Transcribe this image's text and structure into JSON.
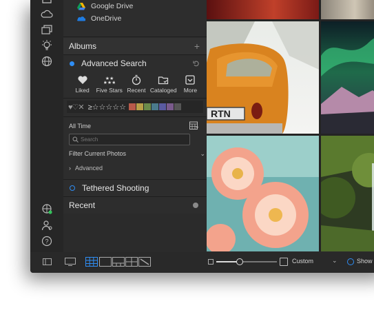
{
  "cloud_items": [
    {
      "label": "Google Drive",
      "icon": "google-drive-icon"
    },
    {
      "label": "OneDrive",
      "icon": "onedrive-icon"
    }
  ],
  "albums": {
    "label": "Albums",
    "add": "+"
  },
  "advanced_search": {
    "label": "Advanced Search"
  },
  "quick_filters": [
    {
      "label": "Liked",
      "icon": "heart-icon"
    },
    {
      "label": "Five Stars",
      "icon": "five-stars-icon"
    },
    {
      "label": "Recent",
      "icon": "stopwatch-icon"
    },
    {
      "label": "Cataloged",
      "icon": "folder-check-icon"
    },
    {
      "label": "More",
      "icon": "more-checkbox-icon"
    }
  ],
  "rating_bar": {
    "like_icons": "♥♡✕",
    "stars": "≥☆☆☆☆☆",
    "colors": [
      "#b85a4a",
      "#b8a048",
      "#6b8c4a",
      "#4a7a8c",
      "#5a5aa0",
      "#7a5a8c",
      "#555555"
    ]
  },
  "date_filter": {
    "value": "All Time"
  },
  "search": {
    "placeholder": "Search"
  },
  "filter_current": {
    "label": "Filter Current Photos"
  },
  "advanced": {
    "label": "Advanced"
  },
  "tethered": {
    "label": "Tethered Shooting"
  },
  "recent": {
    "label": "Recent"
  },
  "toolbar": {
    "custom_label": "Custom",
    "show_label": "Show S",
    "zoom": 0.38
  },
  "accent": "#2f8ef5"
}
